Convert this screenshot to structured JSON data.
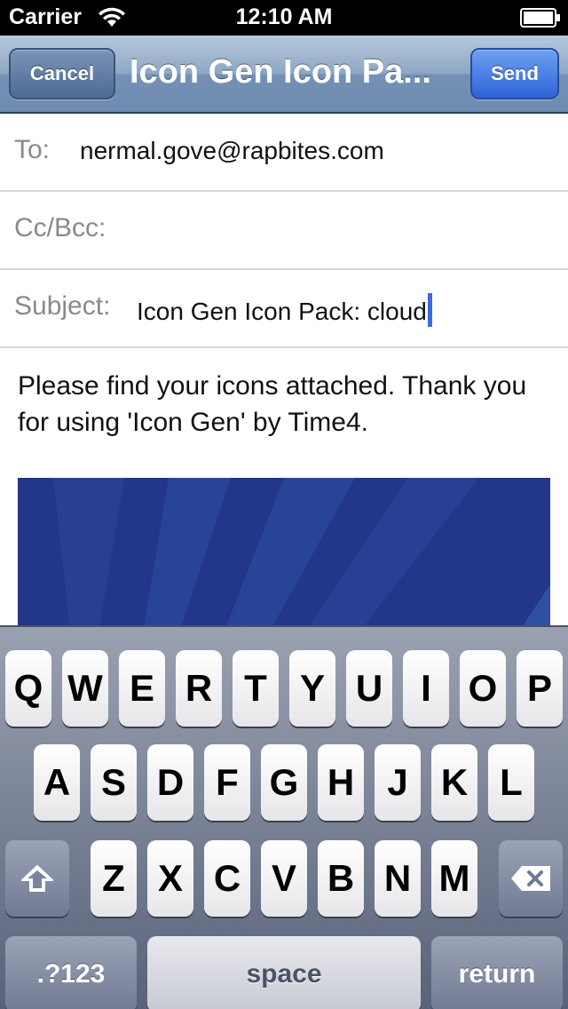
{
  "status_bar": {
    "carrier": "Carrier",
    "time": "12:10 AM"
  },
  "nav": {
    "cancel_label": "Cancel",
    "title": "Icon Gen Icon Pa...",
    "send_label": "Send"
  },
  "compose": {
    "to_label": "To:",
    "to_value": "nermal.gove@rapbites.com",
    "cc_label": "Cc/Bcc:",
    "cc_value": "",
    "subject_label": "Subject:",
    "subject_value": "Icon Gen Icon Pack: cloud",
    "body": "Please find your icons attached. Thank you for using 'Icon Gen' by Time4."
  },
  "keyboard": {
    "row1": [
      "Q",
      "W",
      "E",
      "R",
      "T",
      "Y",
      "U",
      "I",
      "O",
      "P"
    ],
    "row2": [
      "A",
      "S",
      "D",
      "F",
      "G",
      "H",
      "J",
      "K",
      "L"
    ],
    "row3": [
      "Z",
      "X",
      "C",
      "V",
      "B",
      "N",
      "M"
    ],
    "numbers_label": ".?123",
    "space_label": "space",
    "return_label": "return",
    "shift_icon": "shift-arrow-icon",
    "delete_icon": "backspace-icon"
  },
  "colors": {
    "nav_accent": "#7591b5",
    "send_button": "#2e63d8",
    "cursor": "#3c6be0",
    "attachment_blue": "#22368a"
  }
}
